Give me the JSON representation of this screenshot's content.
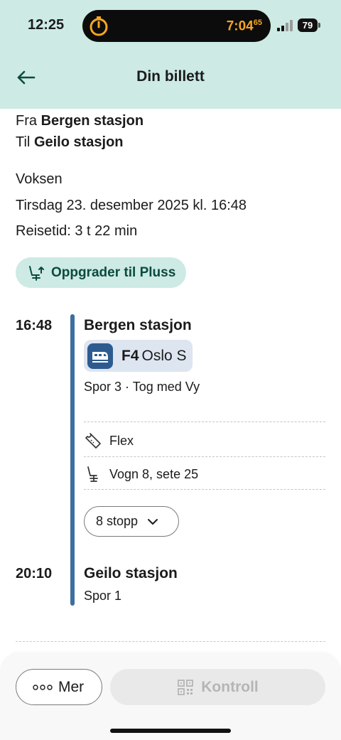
{
  "status_bar": {
    "time": "12:25",
    "timer_main": "7:04",
    "timer_sup": "65",
    "battery": "79"
  },
  "header": {
    "title": "Din billett",
    "back_icon": "arrow-left-icon"
  },
  "trip": {
    "from_prefix": "Fra",
    "from_station": "Bergen stasjon",
    "to_prefix": "Til",
    "to_station": "Geilo stasjon",
    "passenger": "Voksen",
    "datetime": "Tirsdag 23. desember 2025 kl. 16:48",
    "duration": "Reisetid: 3 t 22 min"
  },
  "upgrade": {
    "label": "Oppgrader til Pluss",
    "icon": "seat-upgrade-icon"
  },
  "journey": {
    "departure": {
      "time": "16:48",
      "station": "Bergen stasjon",
      "platform_info": "Spor 3 · Tog med Vy"
    },
    "train": {
      "line": "F4",
      "destination": "Oslo S",
      "icon": "train-icon"
    },
    "ticket_type": "Flex",
    "seat": "Vogn 8, sete 25",
    "stops_button": "8 stopp",
    "arrival": {
      "time": "20:10",
      "station": "Geilo stasjon",
      "platform": "Spor 1"
    }
  },
  "bottom": {
    "more_label": "Mer",
    "control_label": "Kontroll"
  },
  "colors": {
    "header_bg": "#cdeae4",
    "accent_dark": "#0b4a40",
    "timeline": "#3e6ea1",
    "train_chip": "#dde5f0"
  }
}
